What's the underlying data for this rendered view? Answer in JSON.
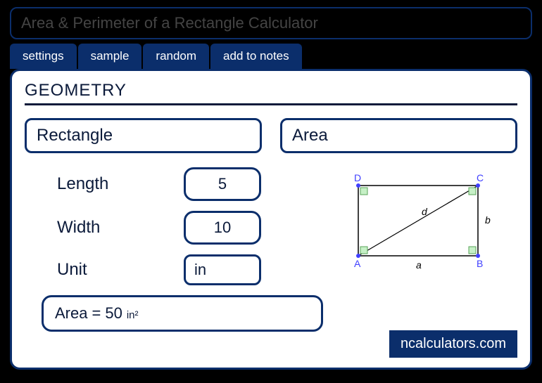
{
  "title": "Area & Perimeter of a Rectangle Calculator",
  "tabs": [
    "settings",
    "sample",
    "random",
    "add to notes"
  ],
  "panel_title": "GEOMETRY",
  "shape_select": "Rectangle",
  "calc_select": "Area",
  "inputs": {
    "length_label": "Length",
    "length_value": "5",
    "width_label": "Width",
    "width_value": "10",
    "unit_label": "Unit",
    "unit_value": "in"
  },
  "result": {
    "label": "Area",
    "eq": "=",
    "value": "50",
    "unit": "in²"
  },
  "diagram": {
    "A": "A",
    "B": "B",
    "C": "C",
    "D": "D",
    "a": "a",
    "b": "b",
    "d": "d"
  },
  "brand": "ncalculators.com"
}
